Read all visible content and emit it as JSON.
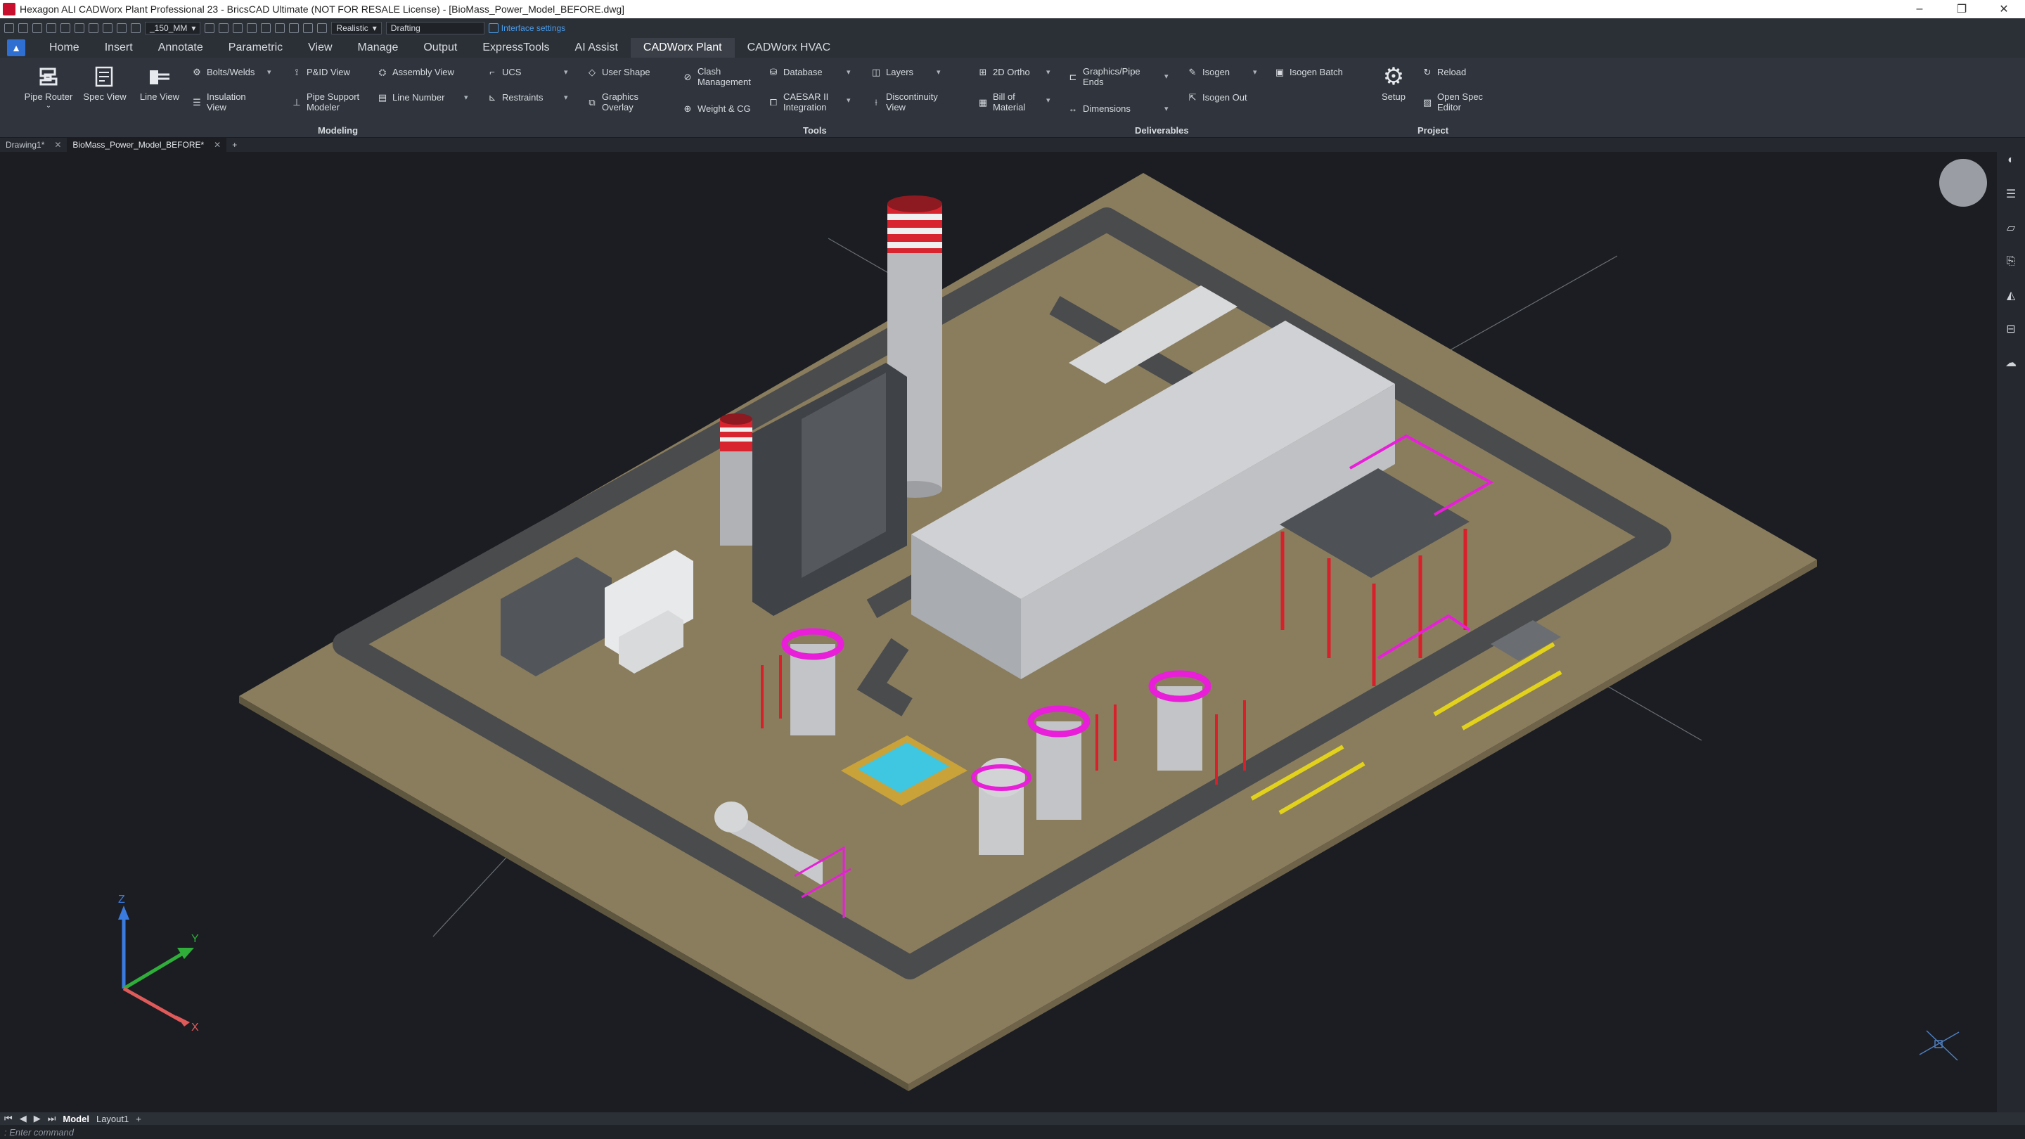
{
  "window": {
    "title": "Hexagon ALI CADWorx Plant Professional 23 - BricsCAD Ultimate (NOT FOR RESALE License) - [BioMass_Power_Model_BEFORE.dwg]",
    "minimize": "–",
    "restore": "❐",
    "close": "✕"
  },
  "qat": {
    "scale": "_150_MM",
    "visual_style": "Realistic",
    "workspace": "Drafting",
    "interface_settings": "Interface settings"
  },
  "menu": {
    "tabs": [
      "Home",
      "Insert",
      "Annotate",
      "Parametric",
      "View",
      "Manage",
      "Output",
      "ExpressTools",
      "AI Assist",
      "CADWorx Plant",
      "CADWorx HVAC"
    ],
    "active": "CADWorx Plant"
  },
  "ribbon": {
    "pipe_router": "Pipe Router",
    "spec_view": "Spec View",
    "line_view": "Line View",
    "bolts_welds": "Bolts/Welds",
    "insulation_view_1": "Insulation",
    "insulation_view_2": "View",
    "pid_view": "P&ID View",
    "pipe_support_1": "Pipe Support",
    "pipe_support_2": "Modeler",
    "assembly_view": "Assembly View",
    "line_number": "Line Number",
    "ucs": "UCS",
    "restraints": "Restraints",
    "user_shape": "User Shape",
    "graphics_overlay_1": "Graphics",
    "graphics_overlay_2": "Overlay",
    "clash_1": "Clash",
    "clash_2": "Management",
    "weight_cg": "Weight & CG",
    "database": "Database",
    "caesar_1": "CAESAR II",
    "caesar_2": "Integration",
    "layers": "Layers",
    "discontinuity_1": "Discontinuity",
    "discontinuity_2": "View",
    "ortho_2d": "2D Ortho",
    "bom_1": "Bill of",
    "bom_2": "Material",
    "graphics_pipe_1": "Graphics/Pipe",
    "graphics_pipe_2": "Ends",
    "dimensions": "Dimensions",
    "isogen": "Isogen",
    "isogen_out": "Isogen Out",
    "isogen_batch": "Isogen Batch",
    "setup": "Setup",
    "reload": "Reload",
    "open_spec_1": "Open Spec",
    "open_spec_2": "Editor",
    "groups": {
      "modeling": "Modeling",
      "tools": "Tools",
      "deliverables": "Deliverables",
      "project": "Project"
    }
  },
  "doc_tabs": [
    "Drawing1*",
    "BioMass_Power_Model_BEFORE*"
  ],
  "doc_tab_add": "+",
  "viewport": {
    "axis_x": "X",
    "axis_y": "Y",
    "axis_z": "Z",
    "colors": {
      "ground": "#8a7d5e",
      "road": "#4a4b4d",
      "building": "#bfc1c4",
      "magenta": "#e81ed8",
      "red": "#d81f2a",
      "yellow": "#e3d21b"
    }
  },
  "layouts": {
    "tabs": [
      "Model",
      "Layout1"
    ],
    "add": "+"
  },
  "command": {
    "prompt": ": Enter command"
  }
}
